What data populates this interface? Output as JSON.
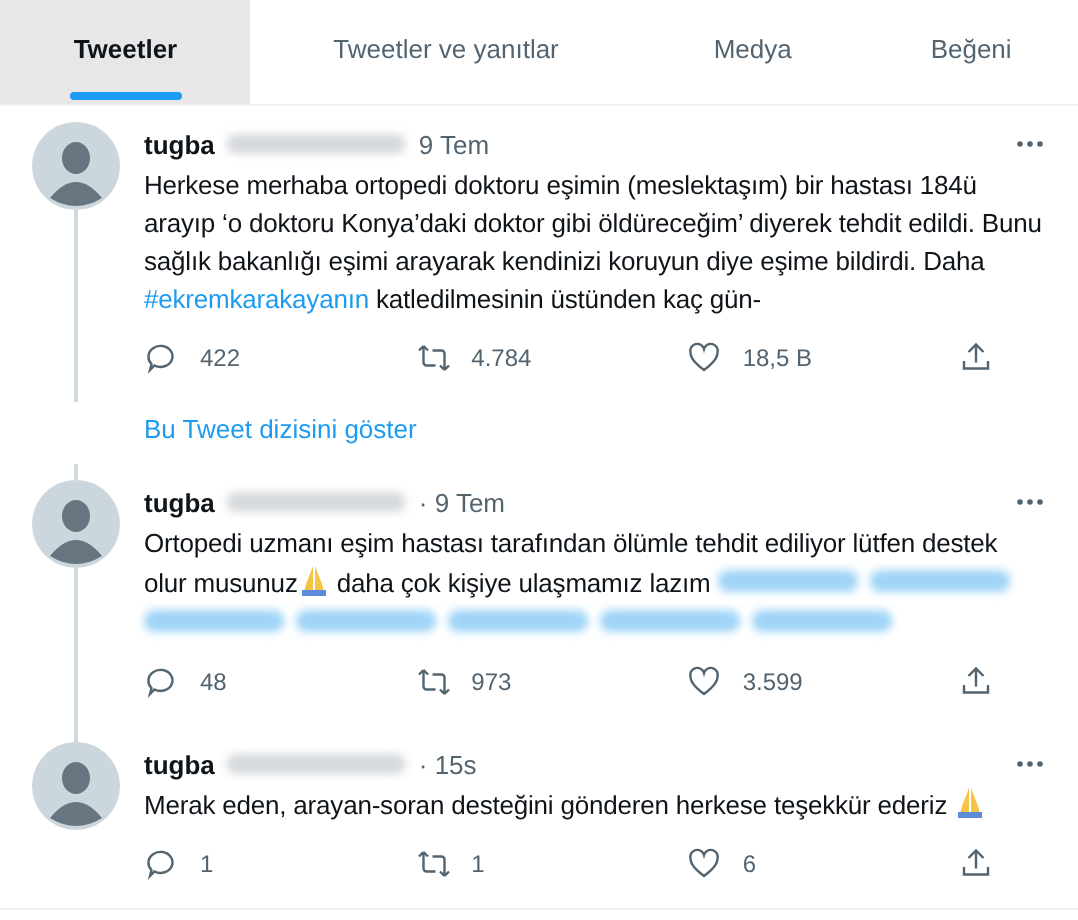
{
  "tabs": [
    {
      "label": "Tweetler",
      "selected": true
    },
    {
      "label": "Tweetler ve yanıtlar",
      "selected": false
    },
    {
      "label": "Medya",
      "selected": false
    },
    {
      "label": "Beğeni",
      "selected": false
    }
  ],
  "tweets": [
    {
      "name": "tugba",
      "time": "9 Tem",
      "thread_below": true,
      "thread_above": false,
      "body": [
        {
          "kind": "text",
          "text": "Herkese merhaba ortopedi doktoru eşimin (meslektaşım) bir hastası 184ü arayıp ‘o doktoru Konya’daki doktor gibi öldüreceğim’ diyerek tehdit edildi. Bunu sağlık bakanlığı eşimi arayarak kendinizi koruyun diye eşime bildirdi. Daha "
        },
        {
          "kind": "hashtag",
          "text": "#ekremkarakayanın"
        },
        {
          "kind": "text",
          "text": " katledilmesinin üstünden kaç gün-"
        }
      ],
      "replies": "422",
      "retweets": "4.784",
      "likes": "18,5 B",
      "show_thread": "Bu Tweet dizisini göster"
    },
    {
      "name": "tugba",
      "time": "· 9 Tem",
      "thread_below": true,
      "thread_above": true,
      "body": [
        {
          "kind": "text",
          "text": "Ortopedi uzmanı eşim hastası tarafından ölümle tehdit ediliyor lütfen destek olur musunuz"
        },
        {
          "kind": "emoji"
        },
        {
          "kind": "text",
          "text": " daha çok kişiye ulaşmamız lazım "
        },
        {
          "kind": "blur"
        },
        {
          "kind": "blur"
        },
        {
          "kind": "blur"
        },
        {
          "kind": "blur"
        },
        {
          "kind": "blur"
        },
        {
          "kind": "blur"
        },
        {
          "kind": "blur"
        }
      ],
      "replies": "48",
      "retweets": "973",
      "likes": "3.599"
    },
    {
      "name": "tugba",
      "time": "· 15s",
      "thread_below": false,
      "thread_above": true,
      "body": [
        {
          "kind": "text",
          "text": "Merak eden, arayan-soran desteğini gönderen herkese teşekkür ederiz "
        },
        {
          "kind": "emoji"
        }
      ],
      "replies": "1",
      "retweets": "1",
      "likes": "6"
    }
  ]
}
